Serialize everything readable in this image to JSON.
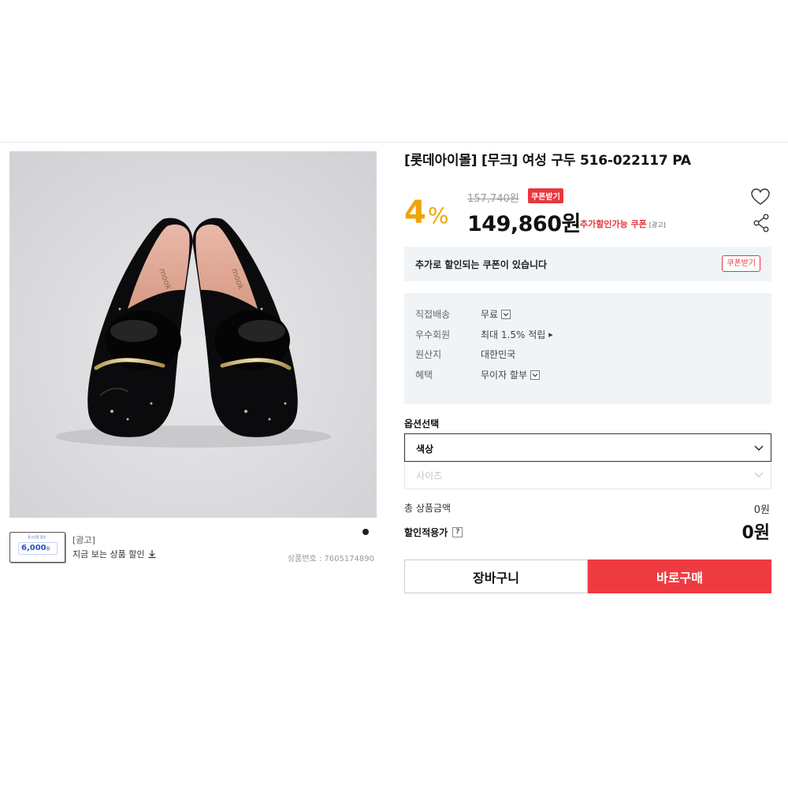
{
  "product": {
    "title": "[롯데아이몰] [무크] 여성 구두 516-022117 PA",
    "discount_number": "4",
    "discount_symbol": "%",
    "original_price": "157,740원",
    "coupon_badge": "쿠폰받기",
    "sale_price": "149,860원",
    "extra_coupon_text": "추가할인가능 쿠폰",
    "extra_coupon_ad": "[광고]",
    "product_number_label": "상품번호 : ",
    "product_number": "7605174890"
  },
  "image": {
    "brand_text": "mook"
  },
  "ad": {
    "thumb_mini_text": "광고상품 할인",
    "thumb_amount": "6,000",
    "thumb_unit": "원",
    "tag": "[광고]",
    "text": "지금 보는 상품 할인"
  },
  "coupon_bar": {
    "text": "추가로 할인되는 쿠폰이 있습니다",
    "button": "쿠폰받기"
  },
  "info": [
    {
      "key": "직접배송",
      "value": "무료",
      "control": "dropdown"
    },
    {
      "key": "우수회원",
      "value": "최대 1.5% 적립",
      "control": "arrow"
    },
    {
      "key": "원산지",
      "value": "대한민국",
      "control": "none"
    },
    {
      "key": "혜택",
      "value": "무이자 할부",
      "control": "dropdown"
    }
  ],
  "options": {
    "title": "옵션선택",
    "color_placeholder": "색상",
    "size_placeholder": "사이즈"
  },
  "totals": {
    "total_label": "총 상품금액",
    "total_value": "0원",
    "final_label": "할인적용가",
    "help": "?",
    "final_value": "0원"
  },
  "actions": {
    "cart": "장바구니",
    "buy": "바로구매"
  },
  "colors": {
    "discount": "#f0a30a",
    "accent_red": "#e8373d",
    "panel_bg": "#f1f4f7"
  }
}
